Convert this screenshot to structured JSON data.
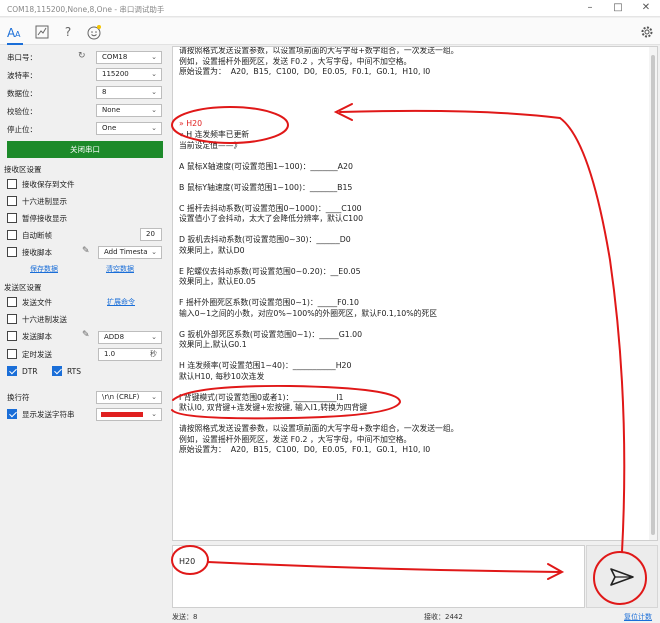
{
  "window": {
    "title": "COM18,115200,None,8,One - 串口调试助手"
  },
  "left": {
    "port_label": "串口号：",
    "port_value": "COM18",
    "baud_label": "波特率：",
    "baud_value": "115200",
    "databits_label": "数据位：",
    "databits_value": "8",
    "parity_label": "校验位：",
    "parity_value": "None",
    "stopbits_label": "停止位：",
    "stopbits_value": "One",
    "close_port": "关闭串口",
    "recv_section": "接收区设置",
    "recv_save_file": "接收保存到文件",
    "recv_hex": "十六进制显示",
    "recv_pause": "暂停接收显示",
    "auto_break": "自动断帧",
    "auto_break_value": "20",
    "recv_script": "接收脚本",
    "recv_script_value": "Add Timesta",
    "save_data": "保存数据",
    "clear_data": "清空数据",
    "send_section": "发送区设置",
    "send_file": "发送文件",
    "extend_cmd": "扩展命令",
    "send_hex": "十六进制发送",
    "send_script": "发送脚本",
    "send_script_value": "ADD8",
    "timed_send": "定时发送",
    "timed_value": "1.0",
    "timed_unit": "秒",
    "dtr": "DTR",
    "rts": "RTS",
    "newline_label": "换行符",
    "newline_value": "\\r\\n (CRLF)",
    "show_send_label": "显示发送字符串",
    "show_send_color": "#e02020"
  },
  "receive": {
    "lines_top": [
      "请按照格式发送设置参数，以设置项前面的大写字母+数字组合，一次发送一组。",
      "例如，设置摇杆外圈死区，发送 F0.2 ，大写字母，中间不加空格。",
      "原始设置为：  A20,  B15,  C100,  D0,  E0.05,  F0.1,  G0.1,  H10, I0"
    ],
    "sent": "» H20",
    "lines_body": [
      "« H 连发频率已更新",
      "当前设定值——》",
      "",
      "A 鼠标X轴速度(可设置范围1~100)：_______A20",
      "",
      "B 鼠标Y轴速度(可设置范围1~100)：_______B15",
      "",
      "C 摇杆去抖动系数(可设置范围0~1000)：____C100",
      "设置值小了会抖动，太大了会降低分辨率，默认C100",
      "",
      "D 扳机去抖动系数(可设置范围0~30)：______D0",
      "效果同上，默认D0",
      "",
      "E 陀螺仪去抖动系数(可设置范围0~0.20)：__E0.05",
      "效果同上，默认E0.05",
      "",
      "F 摇杆外圈死区系数(可设置范围0~1)：_____F0.10",
      "输入0~1之间的小数，对应0%~100%的外圈死区，默认F0.1,10%的死区",
      "",
      "G 扳机外部死区系数(可设置范围0~1)：_____G1.00",
      "效果同上,默认G0.1",
      "",
      "H 连发频率(可设置范围1~40)：___________H20",
      "默认H10, 每秒10次连发",
      "",
      "I 背键模式(可设置范围0或者1)：___________I1",
      "默认I0, 双背键+连发键+宏按键, 输入I1,转换为四背键",
      "",
      "请按照格式发送设置参数，以设置项前面的大写字母+数字组合，一次发送一组。",
      "例如，设置摇杆外圈死区，发送 F0.2 ，大写字母，中间不加空格。",
      "原始设置为：  A20,  B15,  C100,  D0,  E0.05,  F0.1,  G0.1,  H10, I0"
    ]
  },
  "send": {
    "value": "H20"
  },
  "status": {
    "sent": "发送：8",
    "received": "接收：2442",
    "reset": "复位计数"
  }
}
